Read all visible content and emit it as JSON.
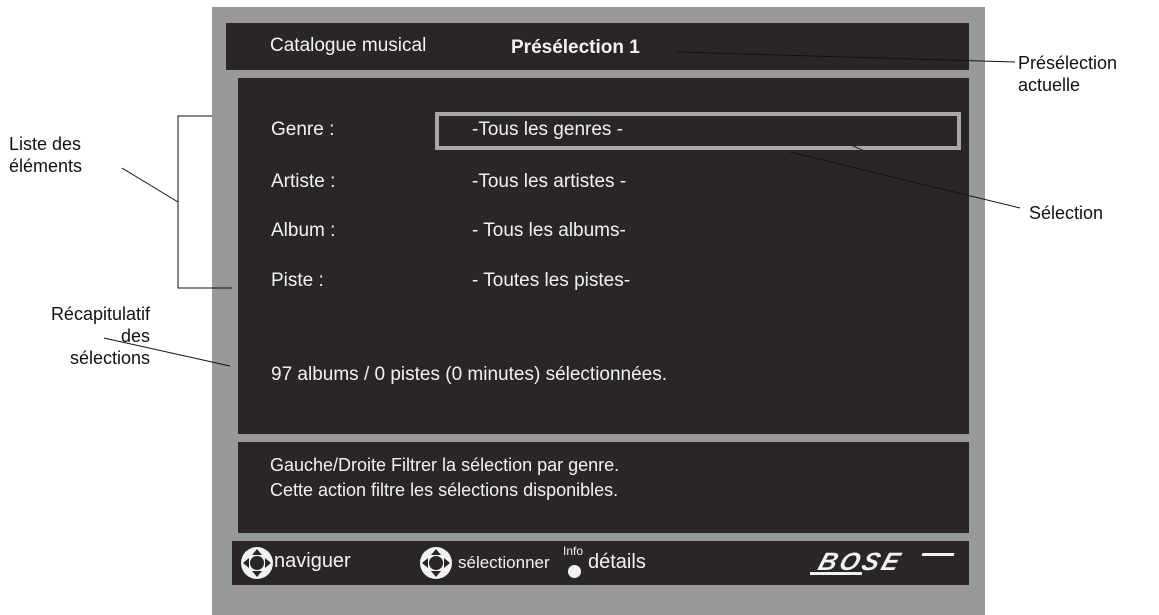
{
  "screen": {
    "header": {
      "title": "Catalogue musical",
      "preset": "Présélection 1"
    },
    "rows": [
      {
        "label": "Genre :",
        "value": "-Tous les genres -"
      },
      {
        "label": "Artiste :",
        "value": "-Tous les artistes -"
      },
      {
        "label": "Album :",
        "value": "- Tous les albums-"
      },
      {
        "label": "Piste :",
        "value": "- Toutes les pistes-"
      }
    ],
    "summary": "97 albums / 0 pistes (0 minutes) sélectionnées.",
    "help": {
      "line1": "Gauche/Droite Filtrer la sélection par genre.",
      "line2": "Cette action filtre les sélections disponibles."
    },
    "footer": {
      "navigate": "naviguer",
      "select": "sélectionner",
      "info": "Info",
      "details": "détails",
      "logo": "BOSE"
    }
  },
  "callouts": {
    "current_preset": [
      "Présélection",
      "actuelle"
    ],
    "selection": "Sélection",
    "item_list": [
      "Liste des",
      "éléments"
    ],
    "selection_summary": [
      "Récapitulatif",
      "des",
      "sélections"
    ]
  },
  "colors": {
    "frame": "#98999b",
    "panel": "#2a2626",
    "text": "#f2f2f2",
    "highlight_border": "#a7a7a7"
  }
}
